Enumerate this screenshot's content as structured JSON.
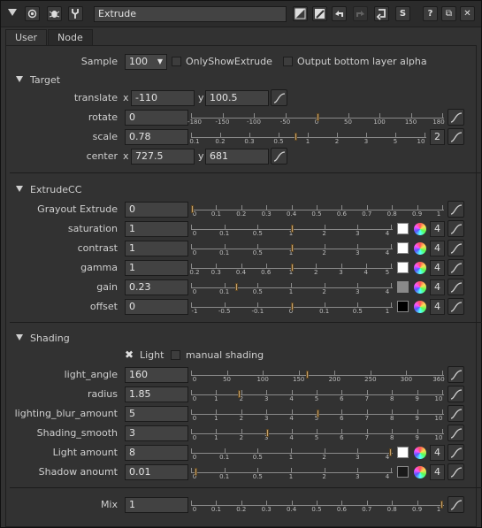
{
  "title": "Extrude",
  "tabs": [
    "User",
    "Node"
  ],
  "titlebar_icons": [
    "expand-triangle-icon",
    "radio-icon",
    "bug-icon",
    "wrench-icon",
    "half-square-icon",
    "slash-square-icon",
    "undo-icon",
    "redo-icon",
    "revert-icon",
    "s-icon",
    "help-icon",
    "float-window-icon",
    "close-icon"
  ],
  "titlebar_glyphs": {
    "help": "?",
    "float": "⧉",
    "close": "✕",
    "s": "S"
  },
  "sample": {
    "label": "Sample",
    "value": "100",
    "cb1": "OnlyShowExtrude",
    "cb2": "Output bottom layer alpha"
  },
  "target": {
    "title": "Target",
    "translate": {
      "label": "translate",
      "x": "-110",
      "y": "100.5"
    },
    "rotate": {
      "label": "rotate",
      "value": "0",
      "ticks": [
        "-180",
        "-150",
        "-100",
        "-50",
        "0",
        "50",
        "100",
        "150",
        "180"
      ]
    },
    "scale": {
      "label": "scale",
      "value": "0.78",
      "count": "2",
      "ticks": [
        "0.1",
        "0.2",
        "0.3",
        "0.5",
        "1",
        "2",
        "3",
        "5",
        "10"
      ]
    },
    "center": {
      "label": "center",
      "x": "727.5",
      "y": "681"
    },
    "xlabel": "x",
    "ylabel": "y"
  },
  "extrudecc": {
    "title": "ExtrudeCC",
    "rows": [
      {
        "label": "Grayout Extrude",
        "value": "0",
        "ticks": [
          "0",
          "0.1",
          "0.2",
          "0.3",
          "0.4",
          "0.5",
          "0.6",
          "0.7",
          "0.8",
          "0.9",
          "1"
        ]
      },
      {
        "label": "saturation",
        "value": "1",
        "count": "4",
        "swatch": "#ffffff",
        "ticks": [
          "0",
          "0.1",
          "0.5",
          "1",
          "2",
          "3",
          "4"
        ]
      },
      {
        "label": "contrast",
        "value": "1",
        "count": "4",
        "swatch": "#ffffff",
        "ticks": [
          "0",
          "0.1",
          "0.5",
          "1",
          "2",
          "3",
          "4"
        ]
      },
      {
        "label": "gamma",
        "value": "1",
        "count": "4",
        "swatch": "#ffffff",
        "ticks": [
          "0.2",
          "0.3",
          "0.4",
          "0.6",
          "1",
          "2",
          "3",
          "4",
          "5"
        ]
      },
      {
        "label": "gain",
        "value": "0.23",
        "count": "4",
        "swatch": "#8a8a8a",
        "ticks": [
          "0",
          "0.1",
          "0.5",
          "1",
          "2",
          "3",
          "4"
        ]
      },
      {
        "label": "offset",
        "value": "0",
        "count": "4",
        "swatch": "#000000",
        "ticks": [
          "-1",
          "-0.5",
          "-0.1",
          "0",
          "0.1",
          "0.5",
          "1"
        ]
      }
    ]
  },
  "shading": {
    "title": "Shading",
    "light_label": "Light",
    "manual_label": "manual shading",
    "rows": [
      {
        "label": "light_angle",
        "value": "160",
        "ticks": [
          "0",
          "50",
          "100",
          "150",
          "200",
          "250",
          "300",
          "360"
        ]
      },
      {
        "label": "radius",
        "value": "1.85",
        "ticks": [
          "0",
          "1",
          "2",
          "3",
          "4",
          "5",
          "6",
          "7",
          "8",
          "9",
          "10"
        ]
      },
      {
        "label": "lighting_blur_amount",
        "value": "5",
        "ticks": [
          "0",
          "1",
          "2",
          "3",
          "4",
          "5",
          "6",
          "7",
          "8",
          "9",
          "10"
        ]
      },
      {
        "label": "Shading_smooth",
        "value": "3",
        "ticks": [
          "0",
          "1",
          "2",
          "3",
          "4",
          "5",
          "6",
          "7",
          "8",
          "9",
          "10"
        ]
      },
      {
        "label": "Light amount",
        "value": "8",
        "count": "4",
        "swatch": "#ffffff",
        "ticks": [
          "0",
          "0.1",
          "0.5",
          "1",
          "2",
          "3",
          "4"
        ]
      },
      {
        "label": "Shadow anoumt",
        "value": "0.01",
        "count": "4",
        "swatch": "#1a1a1a",
        "ticks": [
          "0",
          "0.1",
          "0.5",
          "1",
          "2",
          "3",
          "4"
        ]
      }
    ]
  },
  "mix": {
    "label": "Mix",
    "value": "1",
    "ticks": [
      "0",
      "0.1",
      "0.2",
      "0.3",
      "0.4",
      "0.5",
      "0.6",
      "0.7",
      "0.8",
      "0.9",
      "1"
    ]
  },
  "colors": {
    "handle": "#c8a26a",
    "bg": "#323232",
    "field": "#424242"
  }
}
